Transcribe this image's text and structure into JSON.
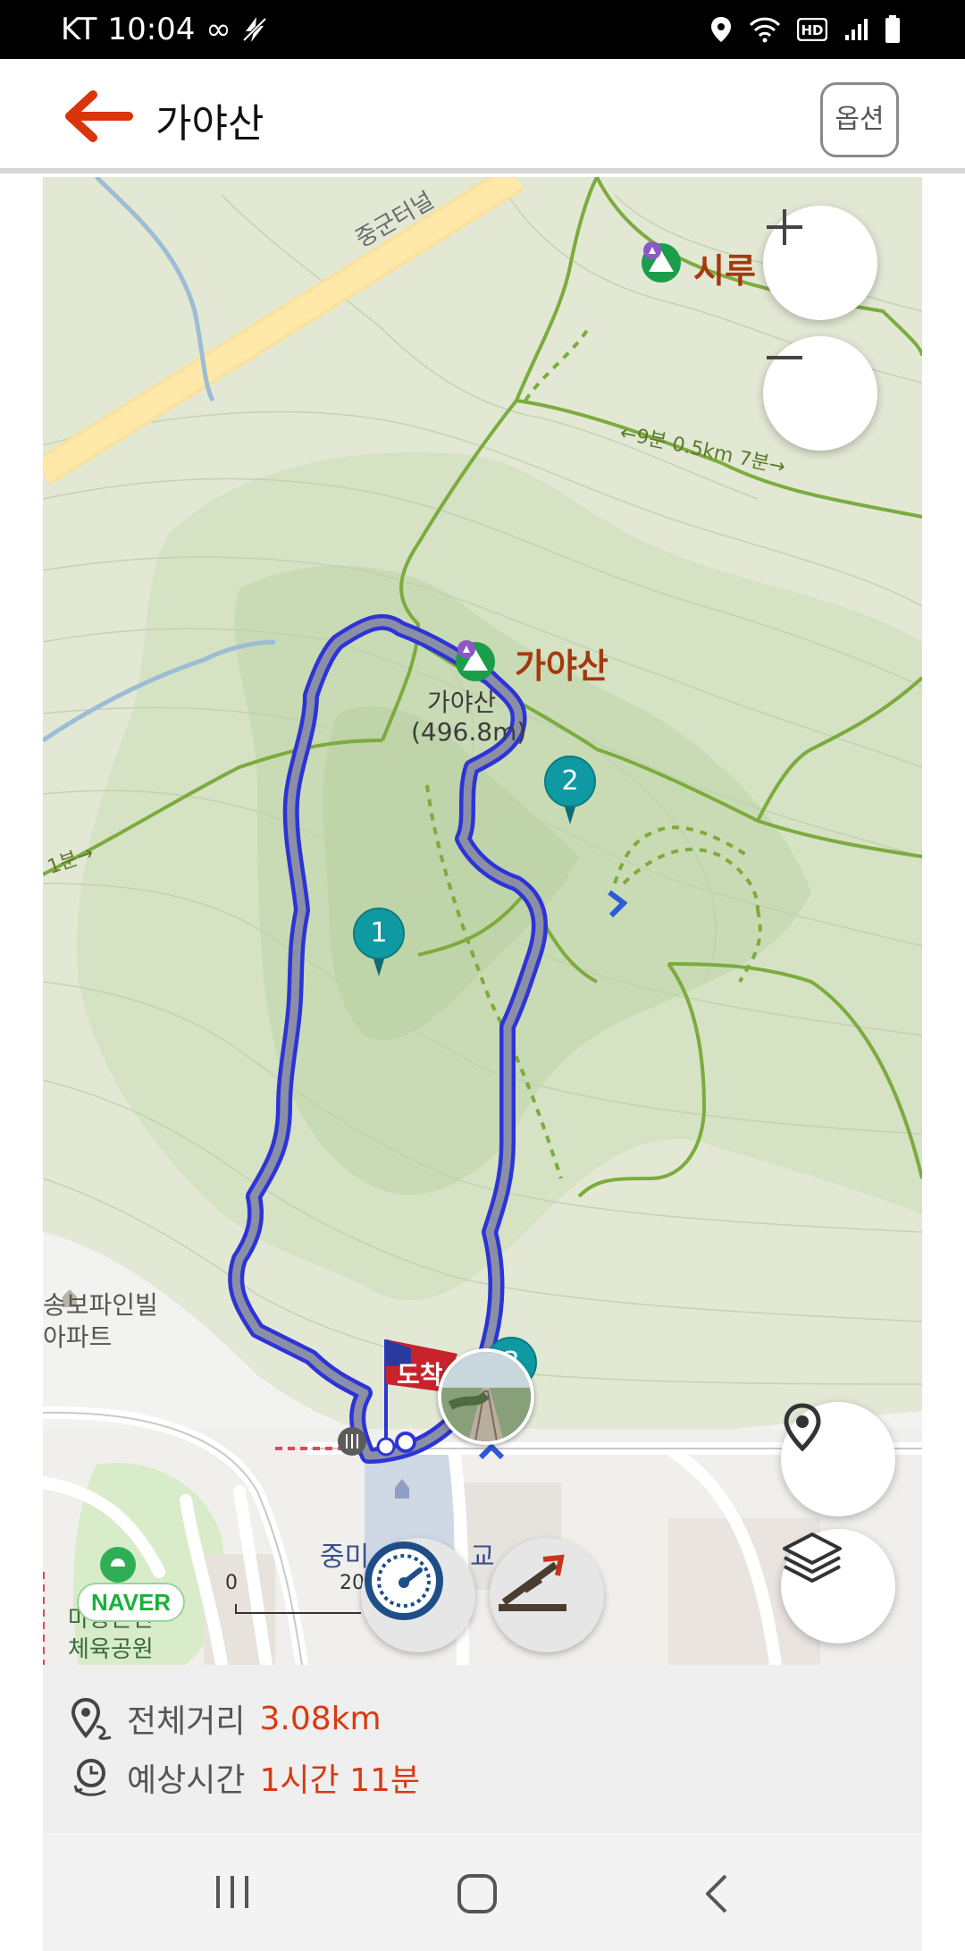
{
  "status_bar": {
    "carrier": "KT",
    "time": "10:04",
    "icons": [
      "infinity-icon",
      "flash-off-icon",
      "location-icon",
      "wifi-icon",
      "hd-icon",
      "signal-icon",
      "battery-icon"
    ]
  },
  "app_bar": {
    "title": "가야산",
    "option_label": "옵션"
  },
  "map": {
    "labels": {
      "tunnel": "중군터널",
      "peak_name": "가야산",
      "peak_sub_name": "가야산",
      "peak_elevation": "(496.8m)",
      "siru": "시루",
      "trail_time": "←9분 0.5km 7분→",
      "trail_left": "1분→",
      "apartment_line1": "송보파인빌",
      "apartment_line2": "아파트",
      "arrival": "도착",
      "park_line1": "마중근린",
      "park_line2": "체육공원",
      "building": "중미",
      "building_suffix": "교",
      "scale_zero": "0",
      "scale_value": "20"
    },
    "waypoints": [
      "1",
      "2",
      "3"
    ],
    "naver_label": "NAVER",
    "colors": {
      "route": "#2d34d6",
      "marker": "#0f9aa3",
      "trail": "#7cab3e",
      "peak_text": "#a5380f"
    }
  },
  "route_info": {
    "distance_label": "전체거리",
    "distance_value": "3.08km",
    "time_label": "예상시간",
    "time_value": "1시간 11분"
  },
  "nav_bar": {
    "icons": [
      "recent-apps-icon",
      "home-icon",
      "back-icon"
    ]
  }
}
